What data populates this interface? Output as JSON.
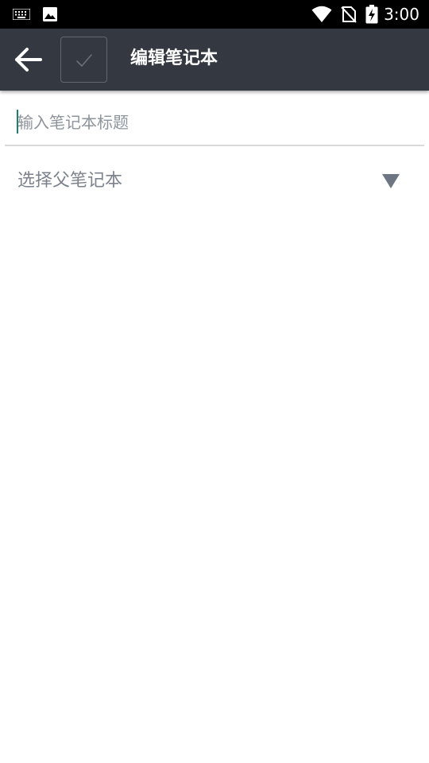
{
  "status_bar": {
    "time": "3:00",
    "icons": [
      "keyboard-icon",
      "image-icon",
      "wifi-icon",
      "no-sim-signal-icon",
      "battery-charging-icon"
    ]
  },
  "toolbar": {
    "title": "编辑笔记本",
    "back_icon": "arrow-left-icon",
    "confirm_icon": "check-icon",
    "background_color": "#343841"
  },
  "form": {
    "title_input": {
      "value": "",
      "placeholder": "输入笔记本标题"
    },
    "parent_select": {
      "label": "选择父笔记本",
      "icon": "triangle-down-icon"
    }
  },
  "colors": {
    "accent_cursor": "#1e7f6e",
    "hint_text": "#8e949c",
    "divider": "#d9d9d9"
  }
}
